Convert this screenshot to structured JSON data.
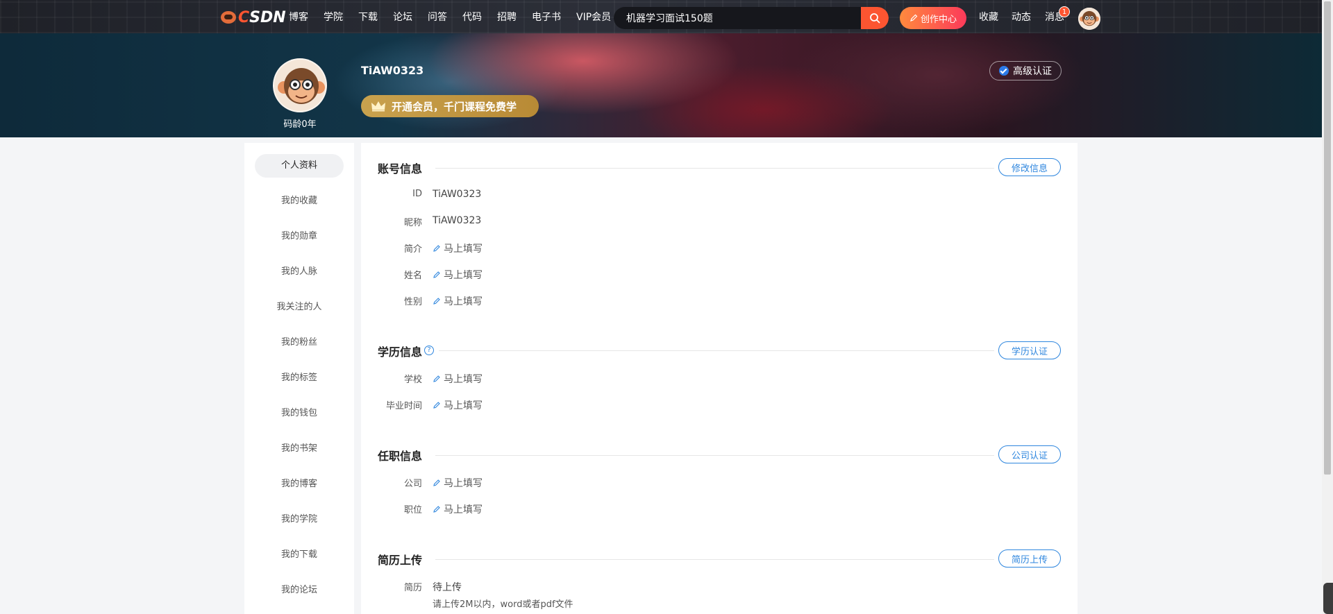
{
  "brand": {
    "logo_text": "CSDN"
  },
  "nav": {
    "items": [
      "博客",
      "学院",
      "下载",
      "论坛",
      "问答",
      "代码",
      "招聘",
      "电子书",
      "VIP会员"
    ],
    "search_value": "机器学习面试150题",
    "create_label": "创作中心",
    "right": [
      "收藏",
      "动态",
      "消息"
    ],
    "message_badge": "1"
  },
  "profile": {
    "username": "TiAW0323",
    "code_age": "码龄0年",
    "vip_promo": "开通会员，千门课程免费学",
    "cert_label": "高级认证"
  },
  "sidebar": {
    "items": [
      "个人资料",
      "我的收藏",
      "我的勋章",
      "我的人脉",
      "我关注的人",
      "我的粉丝",
      "我的标签",
      "我的钱包",
      "我的书架",
      "我的博客",
      "我的学院",
      "我的下载",
      "我的论坛"
    ],
    "active": "个人资料"
  },
  "account": {
    "title": "账号信息",
    "button": "修改信息",
    "fields": [
      {
        "label": "ID",
        "value": "TiAW0323"
      },
      {
        "label": "昵称",
        "value": "TiAW0323"
      },
      {
        "label": "简介",
        "value": "马上填写"
      },
      {
        "label": "姓名",
        "value": "马上填写"
      },
      {
        "label": "性别",
        "value": "马上填写"
      }
    ]
  },
  "education": {
    "title": "学历信息",
    "button": "学历认证",
    "fields": [
      {
        "label": "学校",
        "value": "马上填写"
      },
      {
        "label": "毕业时间",
        "value": "马上填写"
      }
    ]
  },
  "job": {
    "title": "任职信息",
    "button": "公司认证",
    "fields": [
      {
        "label": "公司",
        "value": "马上填写"
      },
      {
        "label": "职位",
        "value": "马上填写"
      }
    ]
  },
  "resume": {
    "title": "简历上传",
    "button": "简历上传",
    "label": "简历",
    "value": "待上传",
    "note": "请上传2M以内，word或者pdf文件"
  },
  "colors": {
    "accent": "#fc5531",
    "link_blue": "#2e86de",
    "vip_gold": "#c9a24e"
  }
}
